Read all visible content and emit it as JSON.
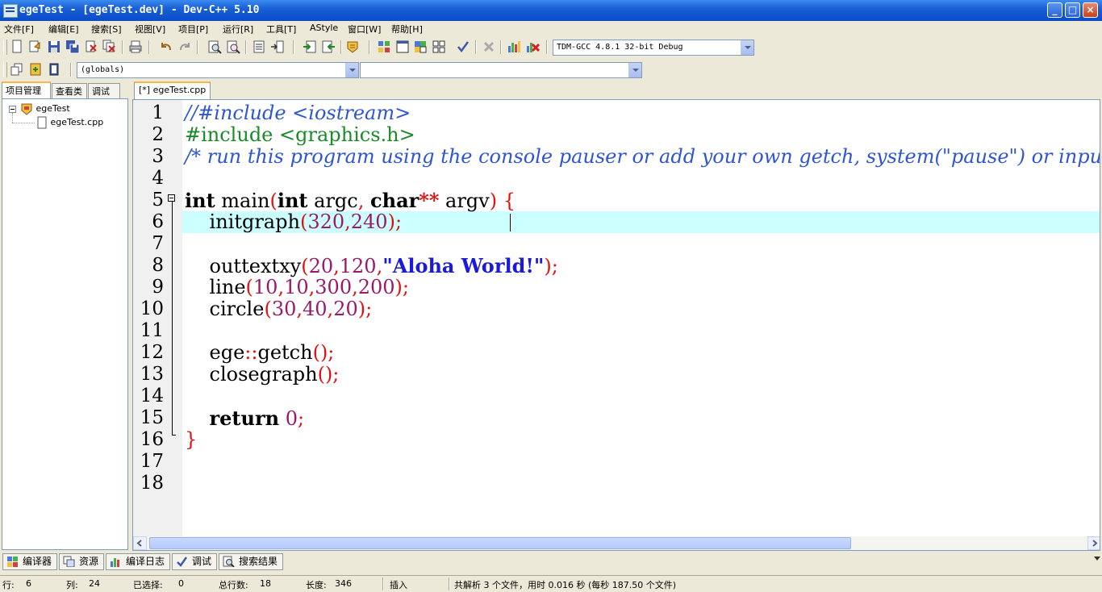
{
  "window": {
    "title": "egeTest - [egeTest.dev] - Dev-C++ 5.10"
  },
  "menu": [
    "文件[F]",
    "编辑[E]",
    "搜索[S]",
    "视图[V]",
    "项目[P]",
    "运行[R]",
    "工具[T]",
    "AStyle",
    "窗口[W]",
    "帮助[H]"
  ],
  "toolbar": {
    "compiler_select": "TDM-GCC 4.8.1 32-bit Debug"
  },
  "classbar": {
    "scope_select": "(globals)",
    "member_select": ""
  },
  "left_panel": {
    "tabs": [
      "项目管理",
      "查看类",
      "调试"
    ],
    "tree": {
      "project": "egeTest",
      "file": "egeTest.cpp"
    }
  },
  "editor": {
    "tab_label": "[*] egeTest.cpp",
    "colors": {
      "comment": "#2f56d2",
      "preprocessor": "#1a8a2a",
      "number": "#9a1a6a",
      "symbol": "#e01010",
      "string": "#1a1ad8",
      "current_line": "#ccffff"
    },
    "line_numbers": [
      "1",
      "2",
      "3",
      "4",
      "5",
      "6",
      "7",
      "8",
      "9",
      "10",
      "11",
      "12",
      "13",
      "14",
      "15",
      "16",
      "17",
      "18"
    ],
    "lines": [
      [
        {
          "t": "//#include <iostream>",
          "c": "comment"
        }
      ],
      [
        {
          "t": "#include <graphics.h>",
          "c": "preprocessor"
        }
      ],
      [
        {
          "t": "/* run this program using the console pauser or add your own getch, system(\"pause\") or input loop */",
          "c": "comment"
        }
      ],
      [],
      [
        {
          "t": "int",
          "c": "keyword"
        },
        {
          "t": " main",
          "c": "plain"
        },
        {
          "t": "(",
          "c": "symbol"
        },
        {
          "t": "int",
          "c": "keyword"
        },
        {
          "t": " argc",
          "c": "plain"
        },
        {
          "t": ",",
          "c": "symbol"
        },
        {
          "t": " ",
          "c": "plain"
        },
        {
          "t": "char",
          "c": "keyword"
        },
        {
          "t": "**",
          "c": "symbol"
        },
        {
          "t": " argv",
          "c": "plain"
        },
        {
          "t": ")",
          "c": "symbol"
        },
        {
          "t": " ",
          "c": "plain"
        },
        {
          "t": "{",
          "c": "symbol"
        }
      ],
      [
        {
          "t": "    initgraph",
          "c": "plain"
        },
        {
          "t": "(",
          "c": "symbol"
        },
        {
          "t": "320",
          "c": "number"
        },
        {
          "t": ",",
          "c": "symbol"
        },
        {
          "t": "240",
          "c": "number"
        },
        {
          "t": ");",
          "c": "symbol"
        }
      ],
      [],
      [
        {
          "t": "    outtextxy",
          "c": "plain"
        },
        {
          "t": "(",
          "c": "symbol"
        },
        {
          "t": "20",
          "c": "number"
        },
        {
          "t": ",",
          "c": "symbol"
        },
        {
          "t": "120",
          "c": "number"
        },
        {
          "t": ",",
          "c": "symbol"
        },
        {
          "t": "\"Aloha World!\"",
          "c": "string"
        },
        {
          "t": ");",
          "c": "symbol"
        }
      ],
      [
        {
          "t": "    line",
          "c": "plain"
        },
        {
          "t": "(",
          "c": "symbol"
        },
        {
          "t": "10",
          "c": "number"
        },
        {
          "t": ",",
          "c": "symbol"
        },
        {
          "t": "10",
          "c": "number"
        },
        {
          "t": ",",
          "c": "symbol"
        },
        {
          "t": "300",
          "c": "number"
        },
        {
          "t": ",",
          "c": "symbol"
        },
        {
          "t": "200",
          "c": "number"
        },
        {
          "t": ");",
          "c": "symbol"
        }
      ],
      [
        {
          "t": "    circle",
          "c": "plain"
        },
        {
          "t": "(",
          "c": "symbol"
        },
        {
          "t": "30",
          "c": "number"
        },
        {
          "t": ",",
          "c": "symbol"
        },
        {
          "t": "40",
          "c": "number"
        },
        {
          "t": ",",
          "c": "symbol"
        },
        {
          "t": "20",
          "c": "number"
        },
        {
          "t": ");",
          "c": "symbol"
        }
      ],
      [],
      [
        {
          "t": "    ege",
          "c": "plain"
        },
        {
          "t": "::",
          "c": "symbol"
        },
        {
          "t": "getch",
          "c": "plain"
        },
        {
          "t": "();",
          "c": "symbol"
        }
      ],
      [
        {
          "t": "    closegraph",
          "c": "plain"
        },
        {
          "t": "();",
          "c": "symbol"
        }
      ],
      [],
      [
        {
          "t": "    ",
          "c": "plain"
        },
        {
          "t": "return",
          "c": "keyword"
        },
        {
          "t": " ",
          "c": "plain"
        },
        {
          "t": "0",
          "c": "number"
        },
        {
          "t": ";",
          "c": "symbol"
        }
      ],
      [
        {
          "t": "}",
          "c": "symbol"
        }
      ],
      [],
      []
    ]
  },
  "bottom_tabs": [
    "编译器",
    "资源",
    "编译日志",
    "调试",
    "搜索结果"
  ],
  "status": {
    "row_label": "行:",
    "row_value": "6",
    "col_label": "列:",
    "col_value": "24",
    "sel_label": "已选择:",
    "sel_value": "0",
    "total_label": "总行数:",
    "total_value": "18",
    "len_label": "长度:",
    "len_value": "346",
    "mode": "插入",
    "parse_msg": "共解析 3 个文件，用时 0.016 秒 (每秒 187.50 个文件)"
  }
}
